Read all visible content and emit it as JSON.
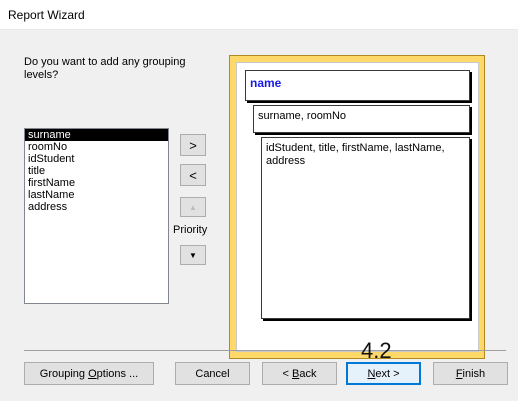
{
  "window": {
    "title": "Report Wizard"
  },
  "question": "Do you want to add any grouping levels?",
  "fields": [
    "surname",
    "roomNo",
    "idStudent",
    "title",
    "firstName",
    "lastName",
    "address"
  ],
  "selected_field_index": 0,
  "controls": {
    "add_label": ">",
    "remove_label": "<",
    "up_icon": "arrow-up-icon",
    "down_icon": "arrow-down-icon",
    "priority_label": "Priority"
  },
  "preview": {
    "group_level_1": "name",
    "group_level_2": "surname, roomNo",
    "detail_fields": "idStudent, title, firstName, lastName, address"
  },
  "overlay_text": "4.2",
  "buttons": {
    "grouping_options": {
      "before": "Grouping ",
      "key": "O",
      "after": "ptions ..."
    },
    "cancel": "Cancel",
    "back": {
      "before": "< ",
      "key": "B",
      "after": "ack"
    },
    "next": {
      "before": "",
      "key": "N",
      "after": "ext >"
    },
    "finish": {
      "before": "",
      "key": "F",
      "after": "inish"
    }
  },
  "colors": {
    "preview_frame": "#ffd86a",
    "group_header_text": "#1a1ae6",
    "focus_border": "#0078d7"
  }
}
